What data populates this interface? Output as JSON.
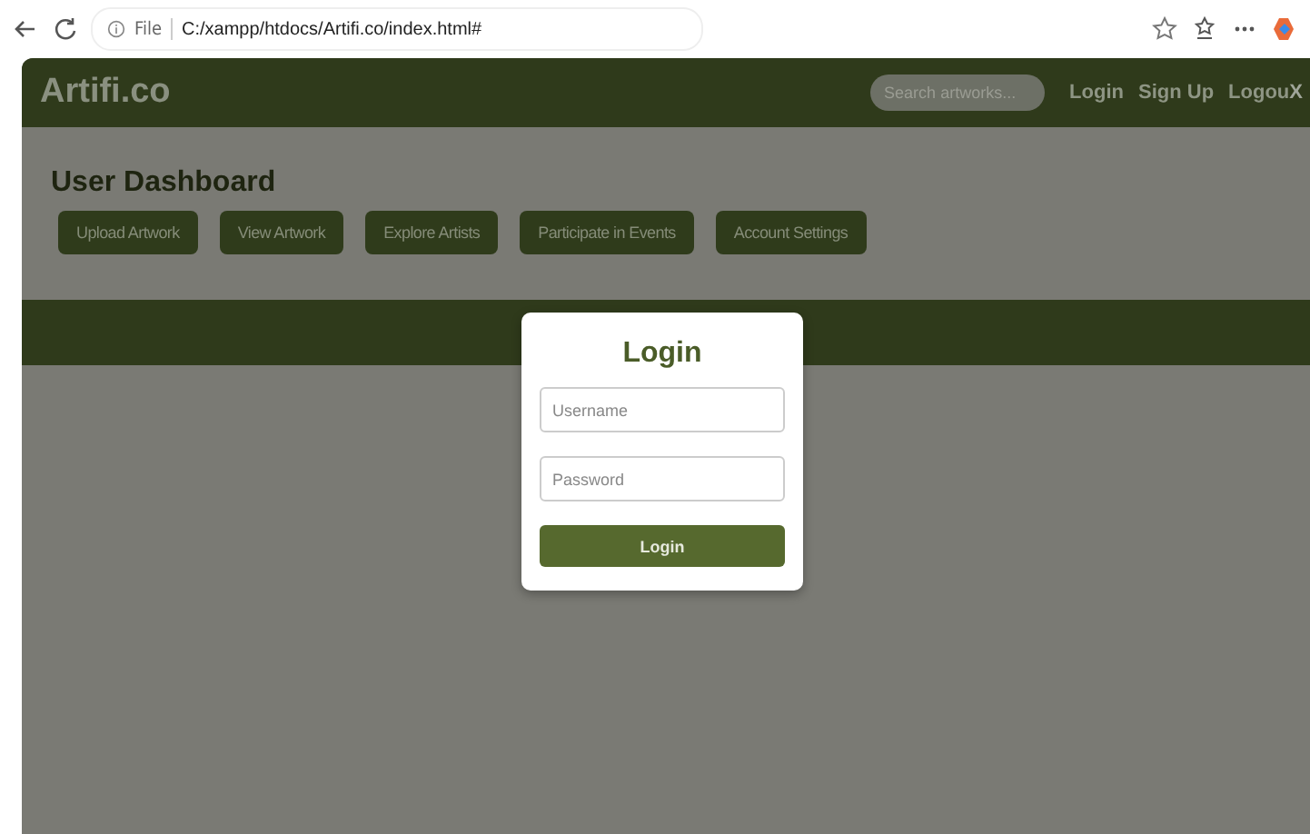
{
  "browser": {
    "scheme": "File",
    "address": "C:/xampp/htdocs/Artifi.co/index.html#"
  },
  "header": {
    "logo": "Artifi.co",
    "search": {
      "placeholder": "Search artworks..."
    },
    "links": [
      "Login",
      "Sign Up",
      "Logou"
    ],
    "close": "X"
  },
  "dashboard": {
    "title": "User Dashboard",
    "buttons": [
      "Upload Artwork",
      "View Artwork",
      "Explore Artists",
      "Participate in Events",
      "Account Settings"
    ]
  },
  "modal": {
    "title": "Login",
    "fields": [
      {
        "placeholder": "Username"
      },
      {
        "placeholder": "Password"
      }
    ],
    "submit": "Login"
  }
}
